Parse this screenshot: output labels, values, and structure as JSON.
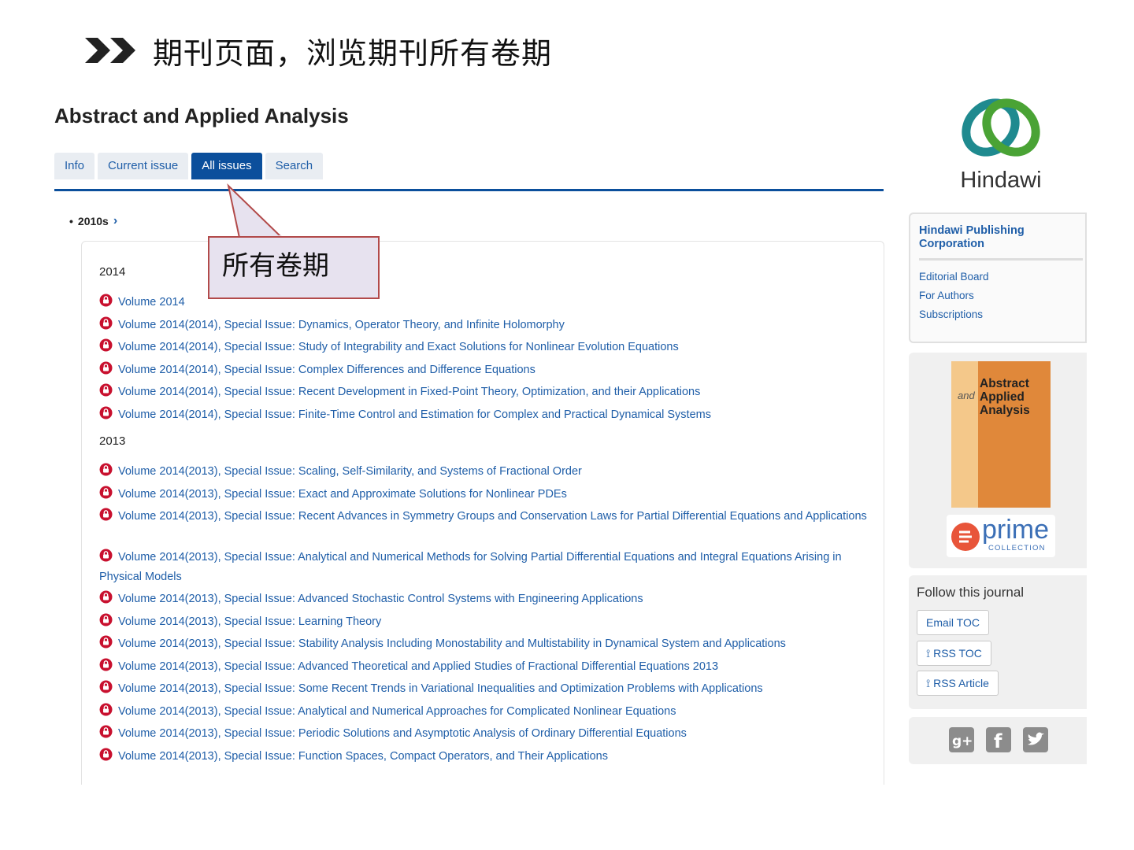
{
  "slide": {
    "title": "期刊页面，浏览期刊所有卷期"
  },
  "journal": {
    "title": "Abstract and Applied Analysis"
  },
  "tabs": [
    {
      "label": "Info"
    },
    {
      "label": "Current issue"
    },
    {
      "label": "All issues"
    },
    {
      "label": "Search"
    }
  ],
  "active_tab": "All issues",
  "decade": {
    "label": "2010s"
  },
  "callout": {
    "text": "所有卷期"
  },
  "years": [
    {
      "year": "2014",
      "volumes": [
        "Volume 2014",
        "Volume 2014(2014), Special Issue: Dynamics, Operator Theory, and Infinite Holomorphy",
        "Volume 2014(2014), Special Issue: Study of Integrability and Exact Solutions for Nonlinear Evolution Equations",
        "Volume 2014(2014), Special Issue: Complex Differences and Difference Equations",
        "Volume 2014(2014), Special Issue: Recent Development in Fixed-Point Theory, Optimization, and their Applications",
        "Volume 2014(2014), Special Issue: Finite-Time Control and Estimation for Complex and Practical Dynamical Systems"
      ]
    },
    {
      "year": "2013",
      "volumes": [
        "Volume 2014(2013), Special Issue: Scaling, Self-Similarity, and Systems of Fractional Order",
        "Volume 2014(2013), Special Issue: Exact and Approximate Solutions for Nonlinear PDEs",
        "Volume 2014(2013), Special Issue: Recent Advances in Symmetry Groups and Conservation Laws for Partial Differential Equations and Applications",
        "Volume 2014(2013), Special Issue: Analytical and Numerical Methods for Solving Partial Differential Equations and Integral Equations Arising in Physical Models",
        "Volume 2014(2013), Special Issue: Advanced Stochastic Control Systems with Engineering Applications",
        "Volume 2014(2013), Special Issue: Learning Theory",
        "Volume 2014(2013), Special Issue: Stability Analysis Including Monostability and Multistability in Dynamical System and Applications",
        "Volume 2014(2013), Special Issue: Advanced Theoretical and Applied Studies of Fractional Differential Equations 2013",
        "Volume 2014(2013), Special Issue: Some Recent Trends in Variational Inequalities and Optimization Problems with Applications",
        "Volume 2014(2013), Special Issue: Analytical and Numerical Approaches for Complicated Nonlinear Equations",
        "Volume 2014(2013), Special Issue: Periodic Solutions and Asymptotic Analysis of Ordinary Differential Equations",
        "Volume 2014(2013), Special Issue: Function Spaces, Compact Operators, and Their Applications"
      ]
    }
  ],
  "sidebar": {
    "logo_text": "Hindawi",
    "publisher": "Hindawi Publishing Corporation",
    "links": [
      "Editorial Board",
      "For Authors",
      "Subscriptions"
    ],
    "cover": {
      "line1": "Abstract",
      "line2": "Applied",
      "line3": "Analysis",
      "and": "and"
    },
    "prime": {
      "word": "prime",
      "sub": "COLLECTION"
    },
    "follow_title": "Follow this journal",
    "follow_buttons": [
      "Email TOC",
      "RSS TOC",
      "RSS Article"
    ],
    "social": [
      "google-plus-icon",
      "facebook-icon",
      "twitter-icon"
    ]
  },
  "colors": {
    "accent": "#0b4f9c",
    "link": "#1f5ea8",
    "lock": "#c8102e",
    "callout_border": "#b24a4a",
    "callout_fill": "#e7e2ef"
  }
}
